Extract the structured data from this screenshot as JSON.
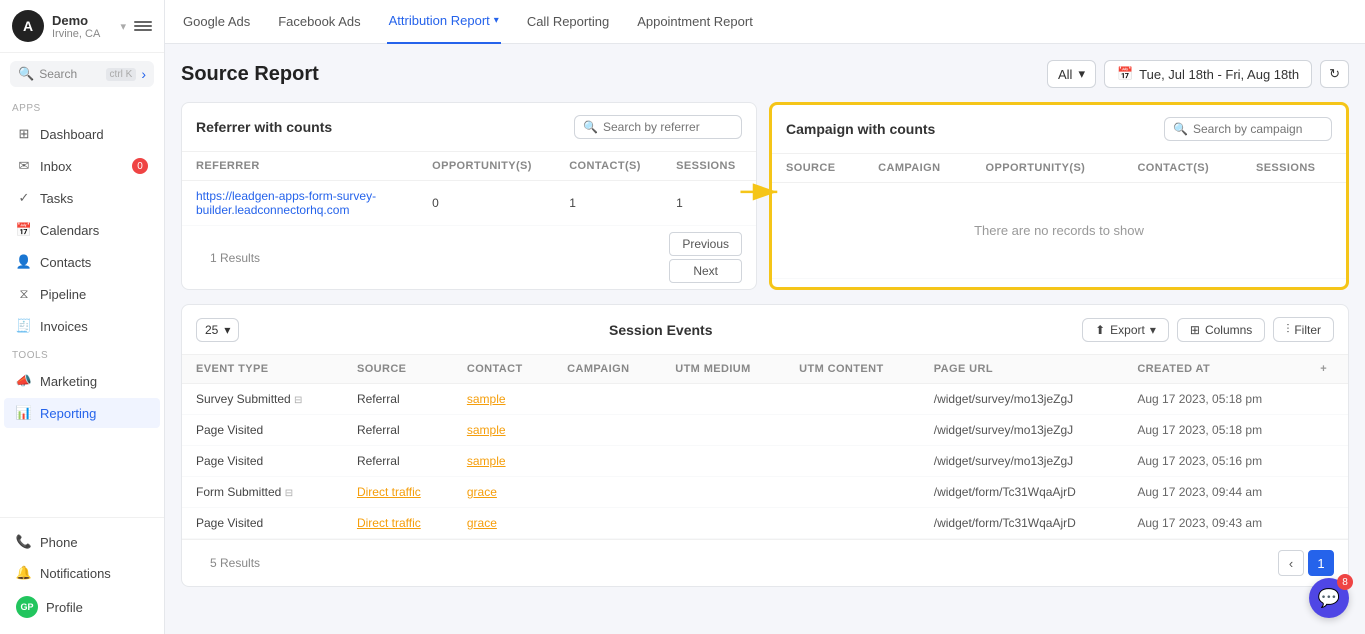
{
  "sidebar": {
    "avatar_letter": "A",
    "user": {
      "name": "Demo",
      "location": "Irvine, CA"
    },
    "search_text": "Search",
    "search_shortcut": "ctrl K",
    "apps_label": "Apps",
    "tools_label": "Tools",
    "items": [
      {
        "label": "Dashboard",
        "icon": "grid"
      },
      {
        "label": "Inbox",
        "icon": "inbox",
        "badge": "0"
      },
      {
        "label": "Tasks",
        "icon": "check"
      },
      {
        "label": "Calendars",
        "icon": "calendar"
      },
      {
        "label": "Contacts",
        "icon": "user"
      },
      {
        "label": "Pipeline",
        "icon": "pipeline"
      },
      {
        "label": "Invoices",
        "icon": "invoice"
      }
    ],
    "tools_items": [
      {
        "label": "Marketing",
        "icon": "megaphone"
      },
      {
        "label": "Reporting",
        "icon": "chart",
        "active": true
      }
    ],
    "bottom_items": [
      {
        "label": "Phone",
        "icon": "phone"
      },
      {
        "label": "Notifications",
        "icon": "bell"
      },
      {
        "label": "Profile",
        "icon": "profile",
        "avatar": "GP"
      }
    ]
  },
  "topnav": {
    "items": [
      {
        "label": "Google Ads",
        "active": false
      },
      {
        "label": "Facebook Ads",
        "active": false
      },
      {
        "label": "Attribution Report",
        "active": true,
        "has_dropdown": true
      },
      {
        "label": "Call Reporting",
        "active": false
      },
      {
        "label": "Appointment Report",
        "active": false
      }
    ]
  },
  "page": {
    "title": "Source Report",
    "filter_all": "All",
    "date_range": "Tue, Jul 18th - Fri, Aug 18th"
  },
  "referrer_panel": {
    "title": "Referrer with counts",
    "search_placeholder": "Search by referrer",
    "columns": [
      "Referrer",
      "Opportunity(s)",
      "Contact(s)",
      "Sessions"
    ],
    "rows": [
      {
        "referrer": "https://leadgen-apps-form-survey-builder.leadconnectorhq.com",
        "opportunities": "0",
        "contacts": "1",
        "sessions": "1"
      }
    ],
    "results_text": "1 Results",
    "previous_label": "Previous",
    "next_label": "Next"
  },
  "campaign_panel": {
    "title": "Campaign with counts",
    "search_placeholder": "Search by campaign",
    "columns": [
      "Source",
      "Campaign",
      "Opportunity(s)",
      "Contact(s)",
      "Sessions"
    ],
    "no_records": "There are no records to show"
  },
  "session_events": {
    "title": "Session Events",
    "per_page": "25",
    "export_label": "Export",
    "columns_label": "Columns",
    "filter_label": "Filter",
    "columns": [
      "Event Type",
      "Source",
      "Contact",
      "Campaign",
      "UTM Medium",
      "UTM Content",
      "Page URL",
      "Created At"
    ],
    "rows": [
      {
        "event_type": "Survey Submitted",
        "event_icon": true,
        "source": "Referral",
        "source_type": "normal",
        "contact": "sample",
        "contact_type": "link",
        "campaign": "",
        "utm_medium": "",
        "utm_content": "",
        "page_url": "/widget/survey/mo13jeZgJ",
        "created_at": "Aug 17 2023, 05:18 pm"
      },
      {
        "event_type": "Page Visited",
        "source": "Referral",
        "source_type": "normal",
        "contact": "sample",
        "contact_type": "link",
        "campaign": "",
        "utm_medium": "",
        "utm_content": "",
        "page_url": "/widget/survey/mo13jeZgJ",
        "created_at": "Aug 17 2023, 05:18 pm"
      },
      {
        "event_type": "Page Visited",
        "source": "Referral",
        "source_type": "normal",
        "contact": "sample",
        "contact_type": "link",
        "campaign": "",
        "utm_medium": "",
        "utm_content": "",
        "page_url": "/widget/survey/mo13jeZgJ",
        "created_at": "Aug 17 2023, 05:16 pm"
      },
      {
        "event_type": "Form Submitted",
        "event_icon": true,
        "source": "Direct traffic",
        "source_type": "link",
        "contact": "grace",
        "contact_type": "link",
        "campaign": "",
        "utm_medium": "",
        "utm_content": "",
        "page_url": "/widget/form/Tc31WqaAjrD",
        "created_at": "Aug 17 2023, 09:44 am"
      },
      {
        "event_type": "Page Visited",
        "source": "Direct traffic",
        "source_type": "link",
        "contact": "grace",
        "contact_type": "link",
        "campaign": "",
        "utm_medium": "",
        "utm_content": "",
        "page_url": "/widget/form/Tc31WqaAjrD",
        "created_at": "Aug 17 2023, 09:43 am"
      }
    ],
    "results_text": "5 Results",
    "current_page": "1"
  },
  "chat_widget": {
    "badge": "8"
  }
}
